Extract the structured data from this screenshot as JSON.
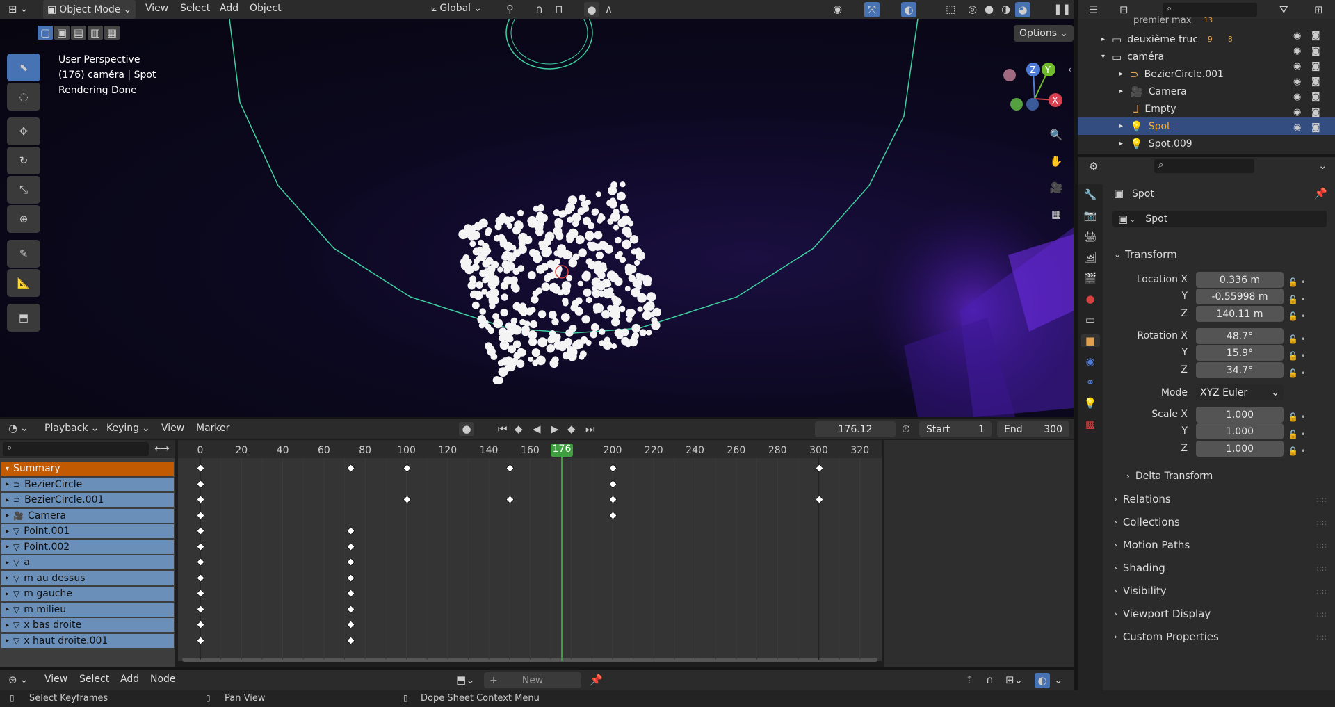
{
  "viewport_header": {
    "mode": "Object Mode",
    "menus": [
      "View",
      "Select",
      "Add",
      "Object"
    ],
    "orientation": "Global",
    "options_label": "Options"
  },
  "viewport_info": {
    "line1": "User Perspective",
    "line2": "(176) caméra | Spot",
    "line3": "Rendering Done"
  },
  "gizmo": {
    "z": "Z",
    "y": "Y",
    "x": "X"
  },
  "outliner": {
    "items": [
      {
        "label": "premier max",
        "badge": "13"
      },
      {
        "label": "deuxième truc",
        "badge": "9",
        "badge2": "8"
      },
      {
        "label": "caméra"
      },
      {
        "label": "BezierCircle.001"
      },
      {
        "label": "Camera"
      },
      {
        "label": "Empty"
      },
      {
        "label": "Spot"
      },
      {
        "label": "Spot.009"
      }
    ]
  },
  "properties": {
    "object_name": "Spot",
    "data_name": "Spot",
    "transform_label": "Transform",
    "location_label": "Location X",
    "rotation_label": "Rotation X",
    "scale_label": "Scale X",
    "y_label": "Y",
    "z_label": "Z",
    "mode_label": "Mode",
    "location": {
      "x": "0.336 m",
      "y": "-0.55998 m",
      "z": "140.11 m"
    },
    "rotation": {
      "x": "48.7°",
      "y": "15.9°",
      "z": "34.7°"
    },
    "rotation_mode": "XYZ Euler",
    "scale": {
      "x": "1.000",
      "y": "1.000",
      "z": "1.000"
    },
    "delta_transform": "Delta Transform",
    "panels": [
      "Relations",
      "Collections",
      "Motion Paths",
      "Shading",
      "Visibility",
      "Viewport Display",
      "Custom Properties"
    ]
  },
  "dopesheet_header": {
    "menus": [
      "Playback",
      "Keying",
      "View",
      "Marker"
    ],
    "current_frame": "176.12",
    "start_label": "Start",
    "start": "1",
    "end_label": "End",
    "end": "300"
  },
  "timeline": {
    "ticks": [
      "0",
      "20",
      "40",
      "60",
      "80",
      "100",
      "120",
      "140",
      "160",
      "200",
      "220",
      "240",
      "260",
      "280",
      "300",
      "320"
    ],
    "current_marker": "176"
  },
  "channels": [
    {
      "label": "Summary",
      "keys": [
        0,
        73,
        100,
        150,
        200,
        300
      ]
    },
    {
      "label": "BezierCircle",
      "keys": [
        0,
        200
      ]
    },
    {
      "label": "BezierCircle.001",
      "keys": [
        0,
        100,
        150,
        200,
        300
      ]
    },
    {
      "label": "Camera",
      "keys": [
        0,
        200
      ]
    },
    {
      "label": "Point.001",
      "keys": [
        0,
        73
      ]
    },
    {
      "label": "Point.002",
      "keys": [
        0,
        73
      ]
    },
    {
      "label": "a",
      "keys": [
        0,
        73
      ]
    },
    {
      "label": "m au dessus",
      "keys": [
        0,
        73
      ]
    },
    {
      "label": "m gauche",
      "keys": [
        0,
        73
      ]
    },
    {
      "label": "m milieu",
      "keys": [
        0,
        73
      ]
    },
    {
      "label": "x bas droite",
      "keys": [
        0,
        73
      ]
    },
    {
      "label": "x haut droite.001",
      "keys": [
        0,
        73
      ]
    }
  ],
  "node_header": {
    "menus": [
      "View",
      "Select",
      "Add",
      "Node"
    ],
    "new_label": "New"
  },
  "statusbar": {
    "select_keyframes": "Select Keyframes",
    "pan_view": "Pan View",
    "context_menu": "Dope Sheet Context Menu"
  },
  "colors": {
    "accent": "#4772b3",
    "summary": "#c15a00",
    "channel": "#6a8fb9",
    "playhead": "#3f9e3f"
  }
}
